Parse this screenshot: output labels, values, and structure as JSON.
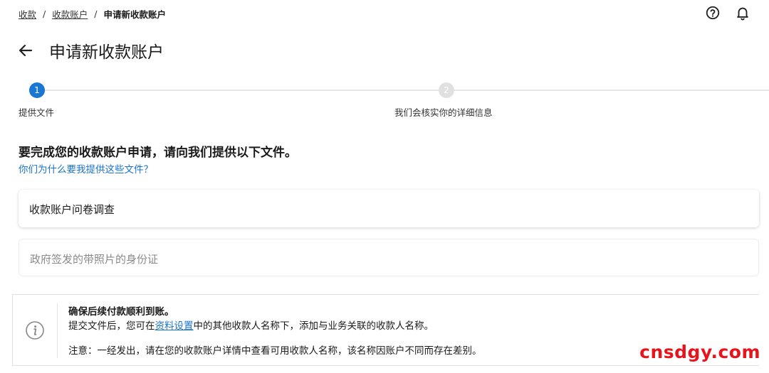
{
  "breadcrumb": {
    "items": [
      "收款",
      "收款账户"
    ],
    "separator": "/",
    "current": "申请新收款账户"
  },
  "header": {
    "title": "申请新收款账户"
  },
  "stepper": {
    "steps": [
      {
        "number": "1",
        "label": "提供文件"
      },
      {
        "number": "2",
        "label": "我们会核实你的详细信息"
      }
    ]
  },
  "main": {
    "heading": "要完成您的收款账户申请，请向我们提供以下文件。",
    "why_link": "你们为什么要我提供这些文件？",
    "documents": [
      {
        "label": "收款账户问卷调查"
      },
      {
        "label": "政府签发的带照片的身份证"
      }
    ]
  },
  "info": {
    "title": "确保后续付款顺利到账。",
    "line1_before": "提交文件后，您可在",
    "line1_link": "资料设置",
    "line1_after": "中的其他收款人名称下，添加与业务关联的收款人名称。",
    "note": "注意：一经发出，请在您的收款账户详情中查看可用收款人名称，该名称因账户不同而存在差别。"
  },
  "watermark": "cnsdgy.com",
  "colors": {
    "accent": "#1976d2",
    "link": "#1a73c8",
    "watermark": "#e8141c"
  }
}
